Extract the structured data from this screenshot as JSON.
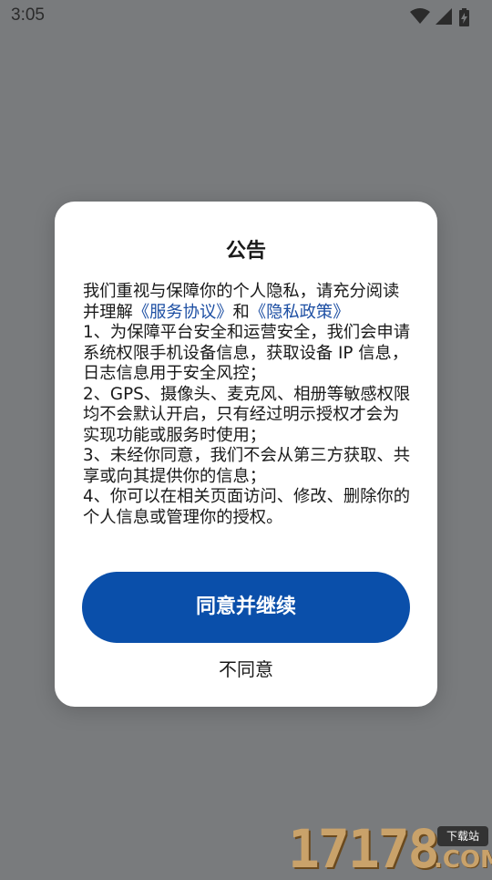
{
  "status_bar": {
    "time": "3:05",
    "icons": [
      "wifi-icon",
      "signal-icon",
      "battery-charging-icon"
    ]
  },
  "dialog": {
    "title": "公告",
    "body": {
      "intro_text": "我们重视与保障你的个人隐私，请充分阅读并理解",
      "service_link": "《服务协议》",
      "and_text": "和",
      "privacy_link": "《隐私政策》",
      "items": [
        "1、为保障平台安全和运营安全，我们会申请系统权限手机设备信息，获取设备 IP 信息，日志信息用于安全风控；",
        "2、GPS、摄像头、麦克风、相册等敏感权限均不会默认开启，只有经过明示授权才会为实现功能或服务时使用；",
        "3、未经你同意，我们不会从第三方获取、共享或向其提供你的信息；",
        "4、你可以在相关页面访问、修改、删除你的个人信息或管理你的授权。"
      ]
    },
    "agree_label": "同意并继续",
    "disagree_label": "不同意"
  },
  "watermark": {
    "digits": "17178",
    "tag": "下载站",
    "domain": ".COM"
  },
  "colors": {
    "overlay_background": "#797b7d",
    "dialog_background": "#ffffff",
    "primary_button": "#0a4faa",
    "link": "#1d4fa3"
  }
}
